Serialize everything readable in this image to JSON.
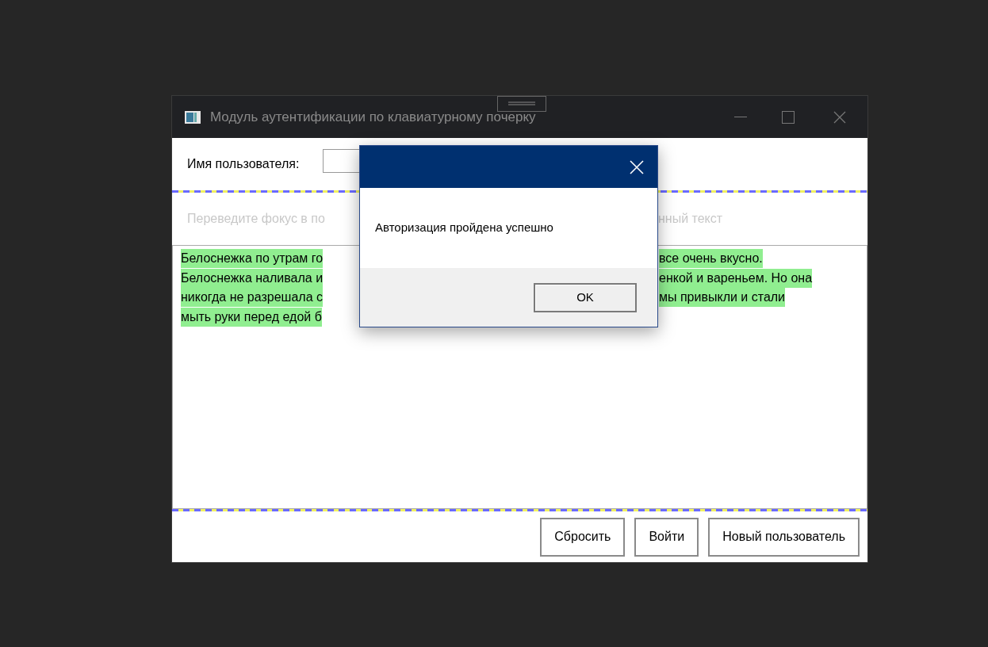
{
  "window": {
    "title": "Модуль аутентификации по клавиатурному почерку"
  },
  "username": {
    "label": "Имя пользователя:"
  },
  "hint": {
    "left": "Переведите фокус в по",
    "right": "нный текст"
  },
  "text_lines": [
    {
      "left": "Белоснежка по утрам го",
      "right": "все очень вкусно."
    },
    {
      "left": "Белоснежка наливала и",
      "right": "енкой и вареньем. Но она"
    },
    {
      "left": "никогда не разрешала с",
      "right": "мы привыкли и стали"
    },
    {
      "left": "мыть руки перед едой б"
    }
  ],
  "buttons": [
    "Сбросить",
    "Войти",
    "Новый пользователь"
  ],
  "dialog": {
    "message": "Авторизация пройдена успешно",
    "button": "OK"
  }
}
